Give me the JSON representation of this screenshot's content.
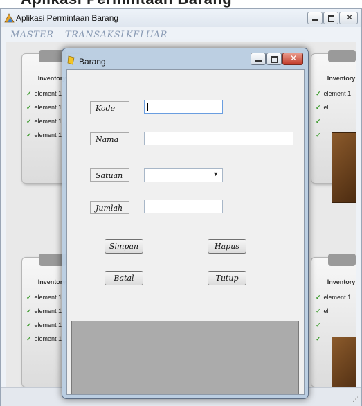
{
  "banner": {
    "text": "Aplikasi Permintaan Barang"
  },
  "app": {
    "title": "Aplikasi Permintaan Barang"
  },
  "menu": {
    "master": "MASTER",
    "transaksi": "TRANSAKSI",
    "keluar": "KELUAR"
  },
  "background": {
    "card_header": "Inventory",
    "card_item": "element 1",
    "card_item_short": "el",
    "card_header_short": "Inv"
  },
  "dialog": {
    "title": "Barang",
    "fields": {
      "kode_label": "Kode",
      "kode_value": "",
      "nama_label": "Nama",
      "nama_value": "",
      "satuan_label": "Satuan",
      "satuan_value": "",
      "jumlah_label": "Jumlah",
      "jumlah_value": ""
    },
    "buttons": {
      "simpan": "Simpan",
      "hapus": "Hapus",
      "batal": "Batal",
      "tutup": "Tutup"
    }
  },
  "colors": {
    "dialog_frame": "#b9cde1",
    "grid": "#ababab",
    "close_button": "#c23a28",
    "menu_text": "#8a9bb4"
  }
}
